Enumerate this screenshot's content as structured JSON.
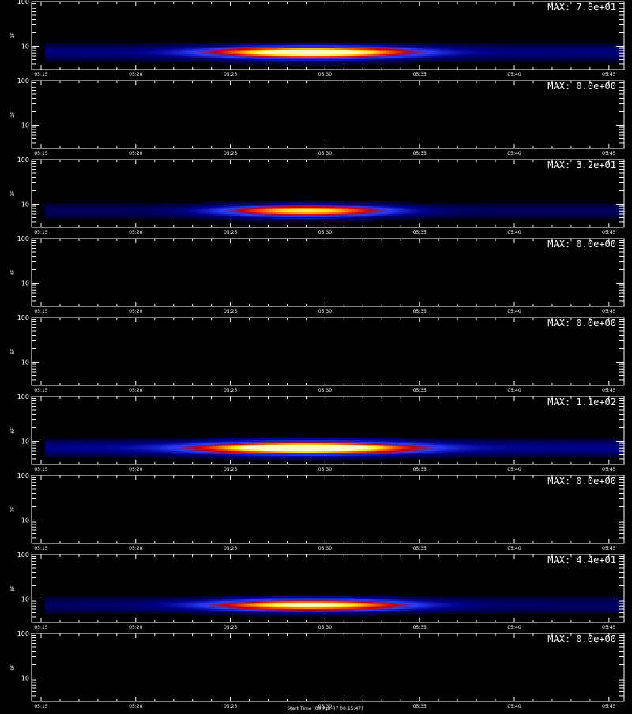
{
  "chart_data": {
    "type": "heatmap",
    "x_tick_labels": [
      "05:15",
      "05:20",
      "05:25",
      "05:30",
      "05:35",
      "05:40",
      "05:45"
    ],
    "x_tick_minutes": [
      15,
      20,
      25,
      30,
      35,
      40,
      45
    ],
    "x_range_minutes": [
      14.5,
      45.8
    ],
    "data_start_minute": 15.2,
    "y_scale": "log",
    "y_range": [
      3,
      100
    ],
    "y_tick_labels": [
      "100",
      "10"
    ],
    "colors": [
      "#000000",
      "#00008c",
      "#2a3cff",
      "#c80000",
      "#ff5a00",
      "#ffe600",
      "#ffffc8"
    ],
    "footer_text": "Start Time (09-Apr-07 00:15:47)",
    "panels": [
      {
        "ylabel": "1F",
        "max_label": "MAX: 7.8e+01",
        "max_value": 78,
        "peak_minute": 29.3,
        "peak_energy": 7.2,
        "duration_sigma": 3.3,
        "band_low_energy": 3.5
      },
      {
        "ylabel": "2F",
        "max_label": "MAX: 0.0e+00",
        "max_value": 0
      },
      {
        "ylabel": "3F",
        "max_label": "MAX: 3.2e+01",
        "max_value": 32,
        "peak_minute": 29.0,
        "peak_energy": 7.0,
        "duration_sigma": 2.8,
        "band_low_energy": 3.8
      },
      {
        "ylabel": "4F",
        "max_label": "MAX: 0.0e+00",
        "max_value": 0
      },
      {
        "ylabel": "5F",
        "max_label": "MAX: 0.0e+00",
        "max_value": 0
      },
      {
        "ylabel": "6F",
        "max_label": "MAX: 1.1e+02",
        "max_value": 110,
        "peak_minute": 29.0,
        "peak_energy": 7.0,
        "duration_sigma": 3.5,
        "band_low_energy": 3.6
      },
      {
        "ylabel": "7F",
        "max_label": "MAX: 0.0e+00",
        "max_value": 0
      },
      {
        "ylabel": "8F",
        "max_label": "MAX: 4.4e+01",
        "max_value": 44,
        "peak_minute": 29.2,
        "peak_energy": 7.3,
        "duration_sigma": 3.3,
        "band_low_energy": 3.2
      },
      {
        "ylabel": "9F",
        "max_label": "MAX: 0.0e+00",
        "max_value": 0
      }
    ]
  }
}
